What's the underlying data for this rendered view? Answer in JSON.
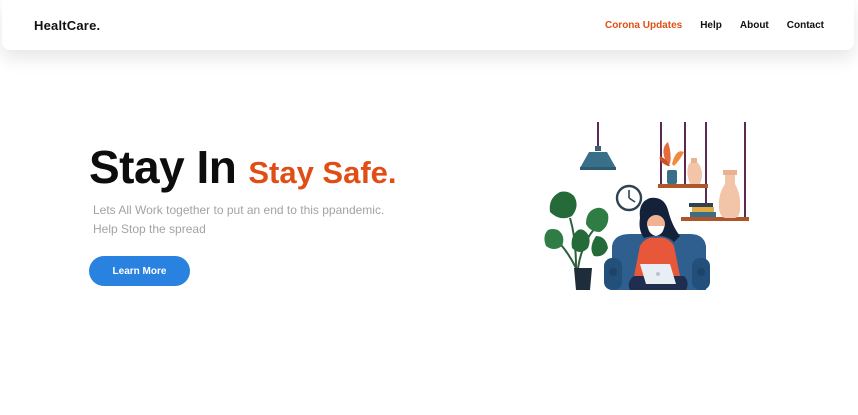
{
  "header": {
    "brand": "HealtCare.",
    "nav": [
      {
        "label": "Corona Updates",
        "active": true
      },
      {
        "label": "Help",
        "active": false
      },
      {
        "label": "About",
        "active": false
      },
      {
        "label": "Contact",
        "active": false
      }
    ]
  },
  "hero": {
    "title_main": "Stay In",
    "title_accent": "Stay Safe.",
    "subtitle_line1": "Lets All Work together to put an end to this ppandemic.",
    "subtitle_line2": "Help Stop the spread",
    "cta_label": "Learn More"
  },
  "colors": {
    "accent": "#e04e16",
    "button": "#2a82e0",
    "text": "#111111",
    "muted": "#a3a3a3"
  },
  "illustration": {
    "icons": [
      "pendant-lamp-icon",
      "wall-clock-icon",
      "monstera-plant-icon",
      "hanging-shelf-icon",
      "vase-icon",
      "book-stack-icon",
      "armchair-icon",
      "person-with-laptop-icon"
    ]
  }
}
